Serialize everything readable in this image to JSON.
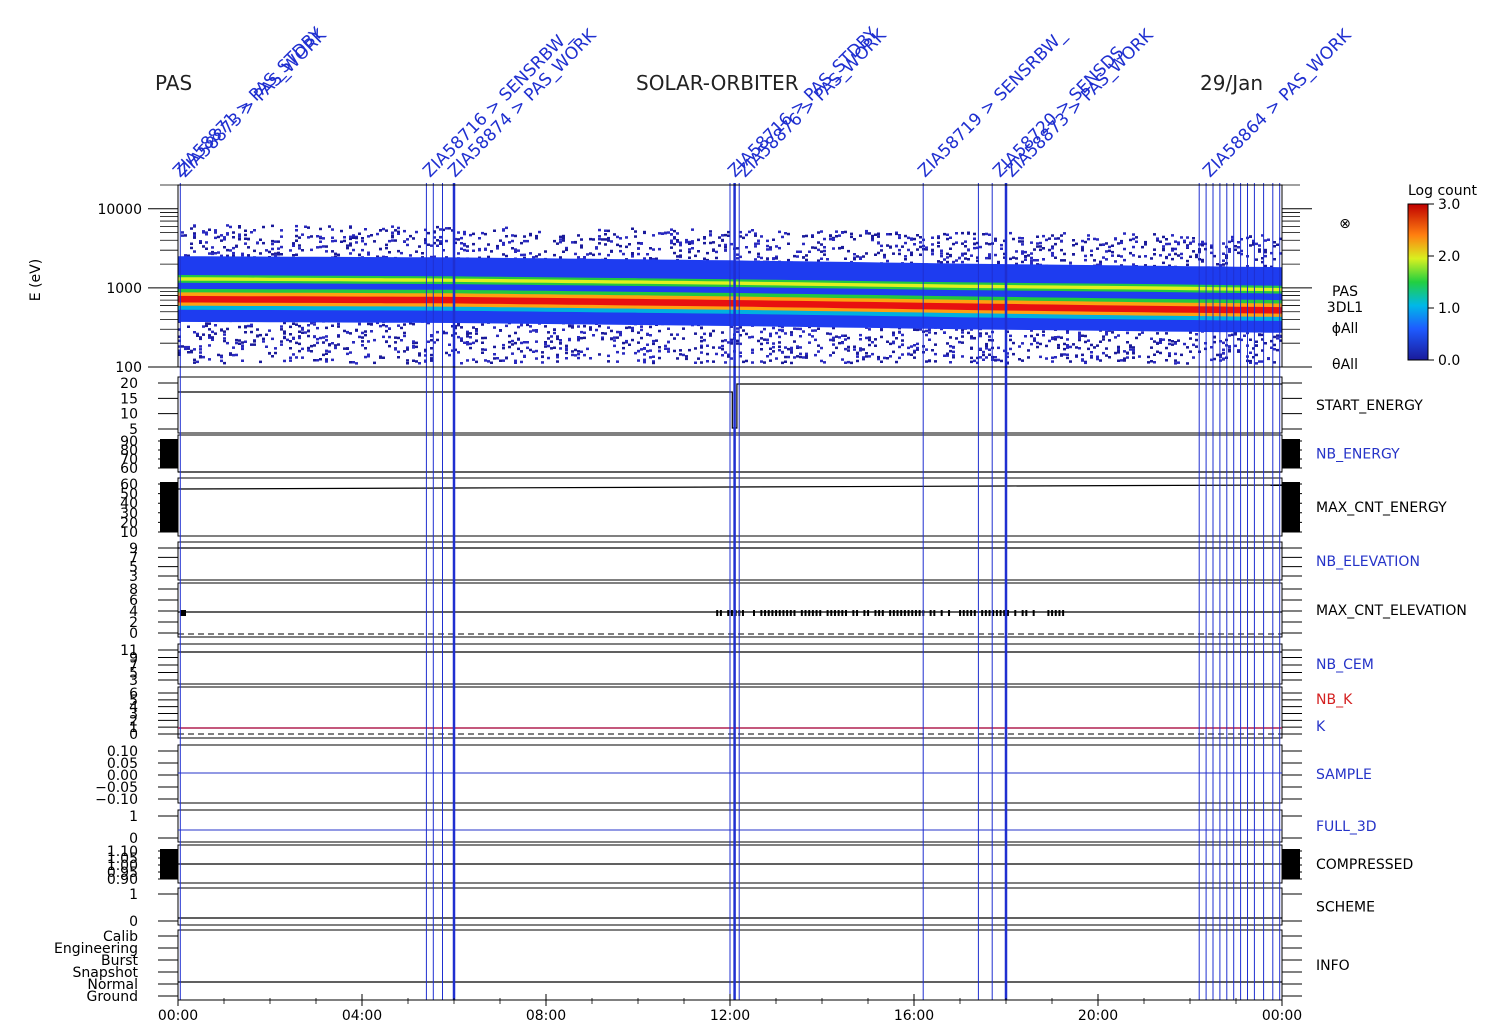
{
  "header": {
    "left": "PAS",
    "center": "SOLAR-ORBITER",
    "right": "29/Jan"
  },
  "colors": {
    "axis": "#000000",
    "event_line": "#1f2fd0",
    "label_blue": "#2533c8",
    "label_red": "#d42020",
    "k_line": "#b02050"
  },
  "chart_data": {
    "type": "heatmap",
    "title": "",
    "ylabel": "E (eV)",
    "ylim": [
      100,
      20000
    ],
    "yscale": "log",
    "y_ticks": [
      "10000",
      "1000",
      "100"
    ],
    "x_ticks": [
      "00:00",
      "04:00",
      "08:00",
      "12:00",
      "16:00",
      "20:00",
      "00:00"
    ],
    "x_hours": [
      0,
      4,
      8,
      12,
      16,
      20,
      24
    ],
    "colorbar": {
      "label": "Log count",
      "ticks": [
        "3.0",
        "2.0",
        "1.0",
        "0.0"
      ],
      "range": [
        0.0,
        3.0
      ]
    },
    "spectrogram_labels": [
      "⊗",
      "PAS",
      "3DL1",
      "ϕAll",
      "θAll"
    ],
    "ridges": [
      {
        "name": "",
        "points": [
          [
            0,
            1300
          ],
          [
            6,
            1250
          ],
          [
            12,
            1150
          ],
          [
            17,
            1050
          ],
          [
            21,
            1000
          ],
          [
            24,
            950
          ]
        ]
      },
      {
        "name": "",
        "points": [
          [
            0,
            720
          ],
          [
            6,
            700
          ],
          [
            12,
            640
          ],
          [
            17,
            580
          ],
          [
            21,
            540
          ],
          [
            24,
            520
          ]
        ]
      }
    ],
    "event_hours": [
      0.05,
      5.4,
      5.55,
      5.75,
      6.0,
      12.0,
      12.1,
      12.2,
      16.2,
      17.4,
      17.7,
      18.0,
      22.2,
      22.35,
      22.5,
      22.65,
      22.8,
      22.95,
      23.1,
      23.25,
      23.4,
      23.6,
      23.8,
      23.95
    ],
    "event_annotations": [
      "ZIA58871 > PAS_STDBY",
      "ZIA58873 > PAS_WORK",
      "ZIA58716 > SENSRBW_",
      "ZIA58874 > PAS_WORK",
      "ZIA58716 > PAS_STDBY",
      "ZIA58876 > PAS_WORK",
      "ZIA58719 > SENSRBW_",
      "ZIA58720 > SENSDS",
      "ZIA58873 > PAS_WORK",
      "ZIA58864 > PAS_WORK"
    ],
    "panels": [
      {
        "name": "START_ENERGY",
        "color": "#000000",
        "ticks": [
          "20",
          "15",
          "10",
          "5"
        ],
        "marker": ""
      },
      {
        "name": "NB_ENERGY",
        "color": "#2533c8",
        "ticks": [
          "90",
          "80",
          "70",
          "60"
        ],
        "marker": ""
      },
      {
        "name": "MAX_CNT_ENERGY",
        "color": "#000000",
        "ticks": [
          "60",
          "50",
          "40",
          "30",
          "20",
          "10"
        ],
        "marker": ""
      },
      {
        "name": "NB_ELEVATION",
        "color": "#2533c8",
        "ticks": [
          "9",
          "7",
          "5",
          "3"
        ],
        "marker": ""
      },
      {
        "name": "MAX_CNT_ELEVATION",
        "color": "#000000",
        "ticks": [
          "8",
          "6",
          "4",
          "2",
          "0"
        ],
        "marker": ""
      },
      {
        "name": "NB_CEM",
        "color": "#2533c8",
        "ticks": [
          "11",
          "9",
          "7",
          "5",
          "3"
        ],
        "marker": ""
      },
      {
        "name": "NB_K",
        "color": "#d42020",
        "ticks": [
          "6",
          "5",
          "4",
          "3",
          "2",
          "1",
          "0"
        ],
        "marker": "K"
      },
      {
        "name": "SAMPLE",
        "color": "#2533c8",
        "ticks": [
          "0.10",
          "0.05",
          "0.00",
          "−0.05",
          "−0.10"
        ],
        "marker": ""
      },
      {
        "name": "FULL_3D",
        "color": "#2533c8",
        "ticks": [
          "1",
          "0"
        ],
        "marker": ""
      },
      {
        "name": "COMPRESSED",
        "color": "#000000",
        "ticks": [
          "1.10",
          "1.05",
          "1.00",
          "0.95",
          "0.90"
        ],
        "marker": ""
      },
      {
        "name": "SCHEME",
        "color": "#000000",
        "ticks": [
          "1",
          "0"
        ],
        "marker": ""
      },
      {
        "name": "INFO",
        "color": "#000000",
        "ticks": [
          "Calib",
          "Engineering",
          "Burst",
          "Snapshot",
          "Normal",
          "Ground"
        ],
        "marker": ""
      }
    ]
  }
}
